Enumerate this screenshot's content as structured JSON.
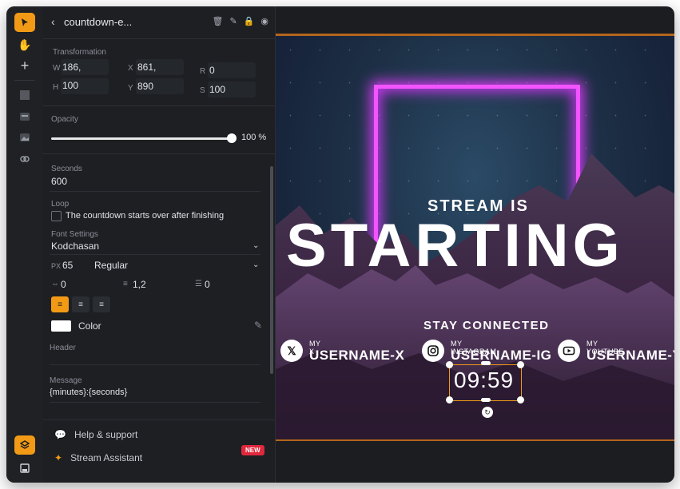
{
  "panel": {
    "title": "countdown-e...",
    "transformation_label": "Transformation",
    "w_label": "W",
    "w_value": "186,",
    "x_label": "X",
    "x_value": "861,",
    "r_label": "R",
    "r_value": "0",
    "h_label": "H",
    "h_value": "100",
    "y_label": "Y",
    "y_value": "890",
    "s_label": "S",
    "s_value": "100",
    "opacity_label": "Opacity",
    "opacity_value": "100 %",
    "seconds_label": "Seconds",
    "seconds_value": "600",
    "loop_label": "Loop",
    "loop_text": "The countdown starts over after finishing",
    "font_settings_label": "Font Settings",
    "font_family": "Kodchasan",
    "px_label": "PX",
    "font_size": "65",
    "font_weight": "Regular",
    "letter_spacing": "0",
    "line_height": "1,2",
    "indent": "0",
    "color_label": "Color",
    "header_label": "Header",
    "message_label": "Message",
    "message_value": "{minutes}:{seconds}",
    "help_label": "Help & support",
    "assistant_label": "Stream Assistant",
    "new_badge": "NEW"
  },
  "stage": {
    "stream_is": "STREAM IS",
    "starting": "STARTING",
    "stay_connected": "STAY CONNECTED",
    "socials": [
      {
        "small": "MY X",
        "big": "USERNAME-X",
        "icon": "x-icon"
      },
      {
        "small": "MY INSTAGRAM",
        "big": "USERNAME-IG",
        "icon": "instagram-icon"
      },
      {
        "small": "MY YOUTUBE",
        "big": "USERNAME-YT",
        "icon": "youtube-icon"
      }
    ],
    "timer": "09:59"
  },
  "colors": {
    "accent": "#f29a16",
    "neon": "#f254ff",
    "badge": "#e0283c"
  }
}
